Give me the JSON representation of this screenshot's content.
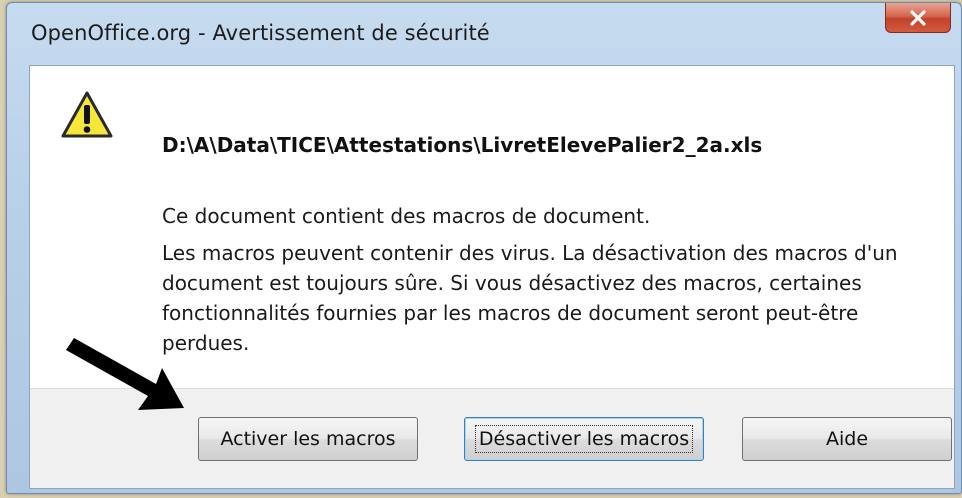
{
  "window": {
    "title": "OpenOffice.org - Avertissement de sécurité",
    "close_label": "x"
  },
  "dialog": {
    "icon": "warning-icon",
    "file_path": "D:\\A\\Data\\TICE\\Attestations\\LivretElevePalier2_2a.xls",
    "message_main": "Ce document contient des macros de document.",
    "message_detail": "Les macros peuvent contenir des virus. La désactivation des macros d'un document est toujours sûre. Si vous désactivez des macros, certaines fonctionnalités fournies par les macros de document seront peut-être perdues."
  },
  "buttons": {
    "activer": "Activer les macros",
    "desactiver": "Désactiver les macros",
    "aide": "Aide"
  },
  "colors": {
    "title_bar": "#b9d0ea",
    "close_button": "#c2412a",
    "warning_yellow": "#f5e63a"
  },
  "annotation": {
    "arrow_icon": "black-arrow-icon"
  }
}
